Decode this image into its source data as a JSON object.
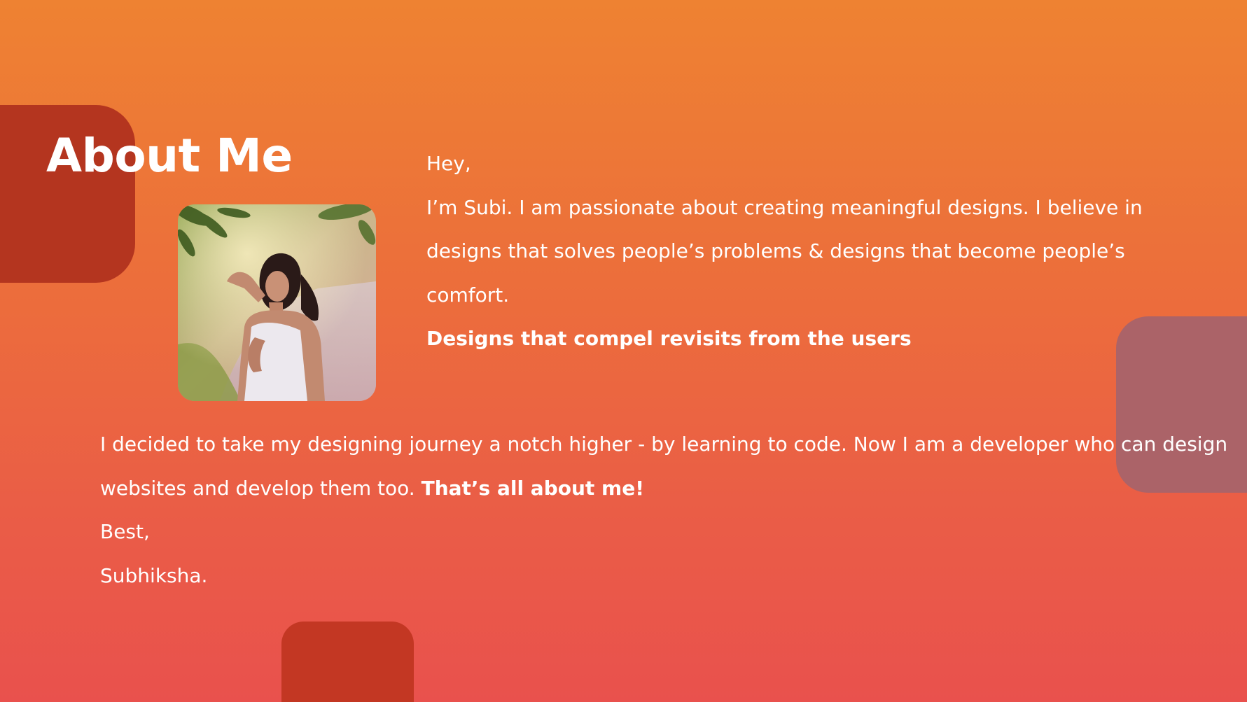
{
  "about": {
    "title": "About Me",
    "portrait_alt": "Portrait of Subhiksha",
    "greeting": "Hey,",
    "intro": "I’m Subi. I am passionate about creating meaningful designs. I believe in designs that solves people’s problems & designs that become  people’s comfort.",
    "tagline": "Designs that compel revisits from the users",
    "journey": "I decided to take my designing journey a notch higher - by learning to code. Now I am a developer who can design websites and develop them too. ",
    "journey_emphasis": "That’s all about  me!",
    "signoff": "Best,",
    "signature": "Subhiksha."
  },
  "colors": {
    "background_top": "#ee8232",
    "background_bottom": "#e9514d",
    "title_block": "#b4351f",
    "right_block": "#a8636a",
    "bottom_block": "#c33723",
    "text": "#ffffff"
  }
}
